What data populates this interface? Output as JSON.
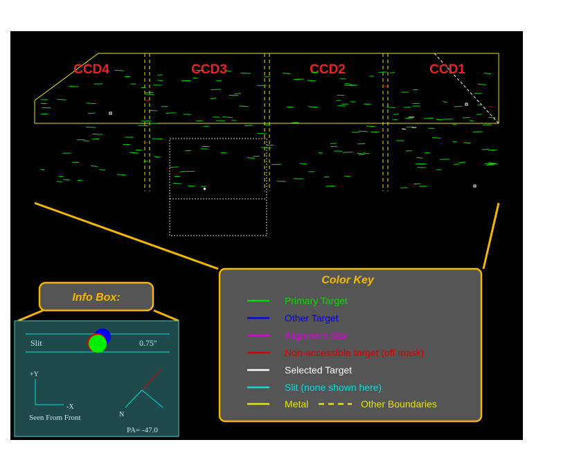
{
  "colors": {
    "background": "#000000",
    "metal": "#e6e600",
    "primary": "#00dd00",
    "other": "#0000ee",
    "alignment": "#dd00dd",
    "nonaccessible": "#dd0000",
    "selected": "#ffffff",
    "slit": "#00e0e0",
    "ccd_label": "#ee2222",
    "info_box_bg": "#1e4a4c",
    "color_key_bg": "#555555",
    "gold": "#f5b800"
  },
  "ccd_labels": [
    "CCD4",
    "CCD3",
    "CCD2",
    "CCD1"
  ],
  "color_key": {
    "title": "Color Key",
    "items": [
      {
        "label": "Primary Target",
        "color": "#00dd00"
      },
      {
        "label": "Other Target",
        "color": "#0000ee"
      },
      {
        "label": "Alignment Star",
        "color": "#dd00dd"
      },
      {
        "label": "Non-accessible target (off mask)",
        "color": "#dd0000"
      },
      {
        "label": "Selected Target",
        "color": "#ffffff"
      },
      {
        "label": "Slit (none shown here)",
        "color": "#00e0e0"
      }
    ],
    "metal_label": "Metal",
    "boundaries_label": "Other Boundaries"
  },
  "info_box": {
    "title": "Info Box:",
    "slit_label": "Slit",
    "slit_width": "0.75''",
    "y_axis": "+Y",
    "x_axis": "-X",
    "view": "Seen From Front",
    "north": "N",
    "pa": "PA= -47.0"
  }
}
